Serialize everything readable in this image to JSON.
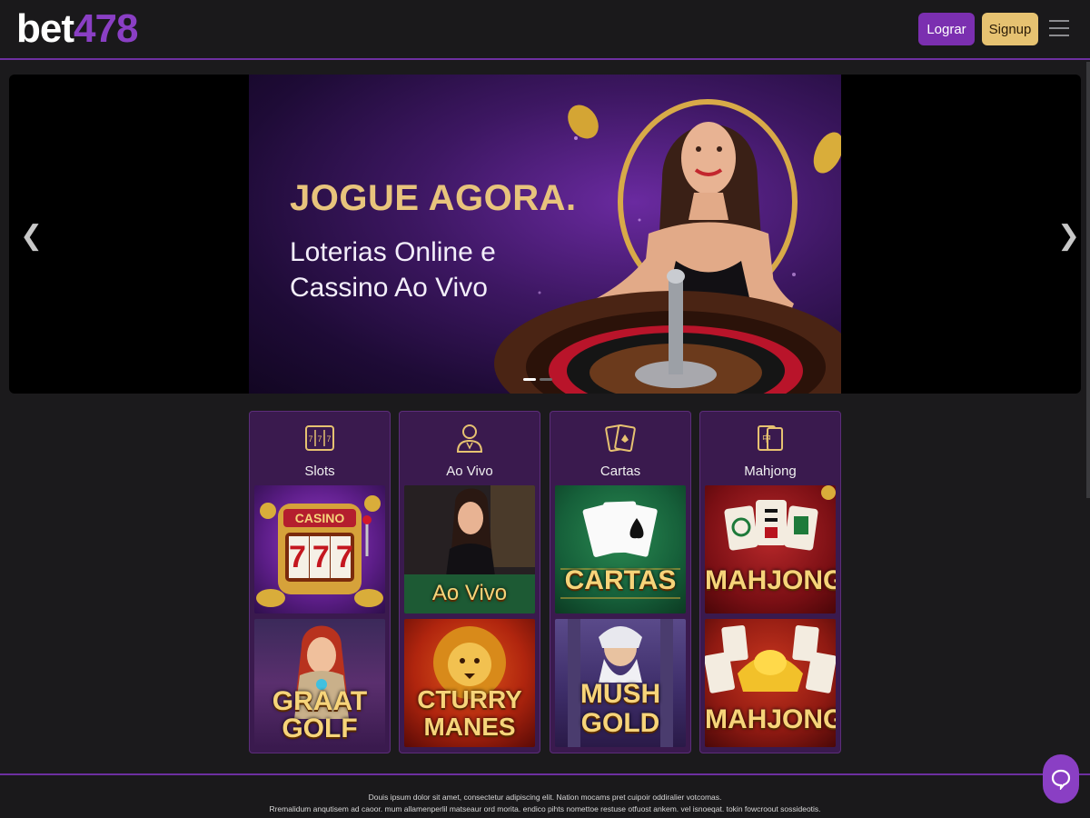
{
  "header": {
    "logo_part1": "bet",
    "logo_part2": "478",
    "login_label": "Lograr",
    "signup_label": "Signup"
  },
  "banner": {
    "headline": "JOGUE AGORA.",
    "subline": "Loterias Online e Cassino Ao Vivo",
    "slides_total": 2,
    "active_slide": 1
  },
  "categories": [
    {
      "label": "Slots",
      "icon": "slot-machine-icon",
      "games": [
        "CASINO 777",
        "GRAAT GOLF"
      ]
    },
    {
      "label": "Ao Vivo",
      "icon": "live-dealer-icon",
      "games": [
        "Ao Vivo",
        "CTURRY MANES"
      ]
    },
    {
      "label": "Cartas",
      "icon": "playing-cards-icon",
      "games": [
        "CARTAS",
        "MUSH GOLD"
      ]
    },
    {
      "label": "Mahjong",
      "icon": "mahjong-tiles-icon",
      "games": [
        "MAHJONG",
        "MAHJONG"
      ]
    }
  ],
  "tiles": {
    "casino_sign": "CASINO",
    "reel": "777",
    "graat": "GRAAT",
    "golf": "GOLF",
    "ao_vivo": "Ao Vivo",
    "cturry": "CTURRY",
    "manes": "MANES",
    "cartas": "CARTAS",
    "mush": "MUSH",
    "gold": "GOLD",
    "mahjong1": "MAHJONG",
    "mahjong2": "MAHJONG"
  },
  "footer": {
    "line1": "Douis ipsum dolor sit amet, consectetur adipiscing elit. Nation mocams pret cuipoir oddiralier votcomas.",
    "line2": "Rremalidum anqutisem ad caoor. mum allamenperlil matseaur ord morita. endico pihts nomettoe restuse otfuost ankem. vel isnoeqat. tokin fowcroout sossideotis."
  },
  "colors": {
    "accent_purple": "#7b2fb0",
    "gold": "#e6c271",
    "card_bg": "#3a1a4e"
  }
}
